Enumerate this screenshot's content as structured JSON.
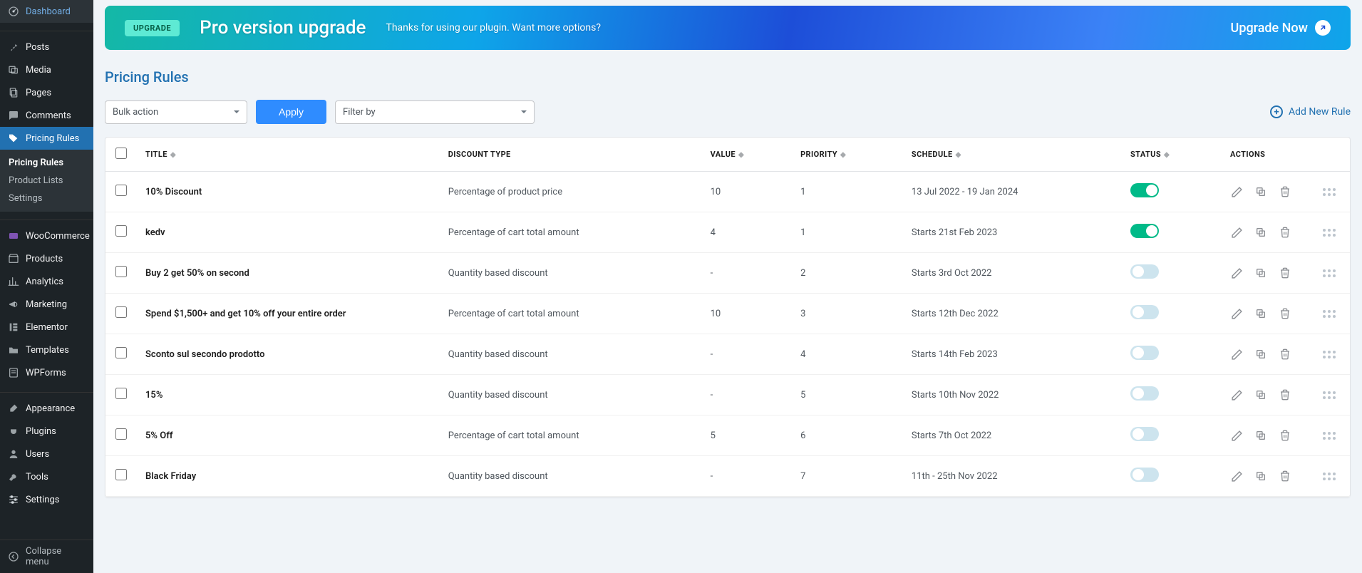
{
  "sidebar": {
    "items": [
      {
        "label": "Dashboard",
        "icon": "dashboard"
      },
      {
        "label": "Posts",
        "icon": "pin"
      },
      {
        "label": "Media",
        "icon": "media"
      },
      {
        "label": "Pages",
        "icon": "page"
      },
      {
        "label": "Comments",
        "icon": "comment"
      },
      {
        "label": "Pricing Rules",
        "icon": "tag",
        "active": true
      },
      {
        "label": "WooCommerce",
        "icon": "woo"
      },
      {
        "label": "Products",
        "icon": "archive"
      },
      {
        "label": "Analytics",
        "icon": "analytics"
      },
      {
        "label": "Marketing",
        "icon": "megaphone"
      },
      {
        "label": "Elementor",
        "icon": "elementor"
      },
      {
        "label": "Templates",
        "icon": "folder"
      },
      {
        "label": "WPForms",
        "icon": "forms"
      },
      {
        "label": "Appearance",
        "icon": "brush"
      },
      {
        "label": "Plugins",
        "icon": "plug"
      },
      {
        "label": "Users",
        "icon": "user"
      },
      {
        "label": "Tools",
        "icon": "wrench"
      },
      {
        "label": "Settings",
        "icon": "sliders"
      }
    ],
    "sub": [
      "Pricing Rules",
      "Product Lists",
      "Settings"
    ],
    "collapse": "Collapse menu"
  },
  "banner": {
    "pill": "UPGRADE",
    "title": "Pro version upgrade",
    "text": "Thanks for using our plugin. Want more options?",
    "cta": "Upgrade Now"
  },
  "page": {
    "title": "Pricing Rules"
  },
  "toolbar": {
    "bulk": "Bulk action",
    "apply": "Apply",
    "filter": "Filter by",
    "add": "Add New Rule"
  },
  "table": {
    "headers": [
      "TITLE",
      "DISCOUNT TYPE",
      "VALUE",
      "PRIORITY",
      "SCHEDULE",
      "STATUS",
      "ACTIONS"
    ],
    "rows": [
      {
        "title": "10% Discount",
        "type": "Percentage of product price",
        "value": "10",
        "priority": "1",
        "schedule": "13 Jul 2022 - 19 Jan 2024",
        "status": true
      },
      {
        "title": "kedv",
        "type": "Percentage of cart total amount",
        "value": "4",
        "priority": "1",
        "schedule": "Starts 21st Feb 2023",
        "status": true
      },
      {
        "title": "Buy 2 get 50% on second",
        "type": "Quantity based discount",
        "value": "-",
        "priority": "2",
        "schedule": "Starts 3rd Oct 2022",
        "status": false
      },
      {
        "title": "Spend $1,500+ and get 10% off your entire order",
        "type": "Percentage of cart total amount",
        "value": "10",
        "priority": "3",
        "schedule": "Starts 12th Dec 2022",
        "status": false
      },
      {
        "title": "Sconto sul secondo prodotto",
        "type": "Quantity based discount",
        "value": "-",
        "priority": "4",
        "schedule": "Starts 14th Feb 2023",
        "status": false
      },
      {
        "title": "15%",
        "type": "Quantity based discount",
        "value": "-",
        "priority": "5",
        "schedule": "Starts 10th Nov 2022",
        "status": false
      },
      {
        "title": "5% Off",
        "type": "Percentage of cart total amount",
        "value": "5",
        "priority": "6",
        "schedule": "Starts 7th Oct 2022",
        "status": false
      },
      {
        "title": "Black Friday",
        "type": "Quantity based discount",
        "value": "-",
        "priority": "7",
        "schedule": "11th - 25th Nov 2022",
        "status": false
      }
    ]
  }
}
